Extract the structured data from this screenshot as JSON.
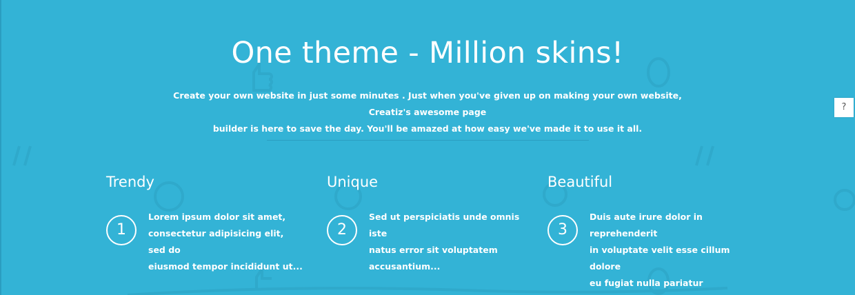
{
  "hero": {
    "title": "One theme - Million skins!",
    "subtitle_line1": "Create your own website in just some minutes . Just when you've given up on making your own website, Creatiz's awesome page",
    "subtitle_line2": "builder is here to save the day. You'll be amazed at how easy we've made it to use it all."
  },
  "features": [
    {
      "title": "Trendy",
      "number": "1",
      "text_line1": "Lorem ipsum dolor sit amet,",
      "text_line2": "consectetur adipisicing elit, sed do",
      "text_line3": "eiusmod tempor incididunt ut..."
    },
    {
      "title": "Unique",
      "number": "2",
      "text_line1": "Sed ut perspiciatis unde omnis iste",
      "text_line2": "natus error sit voluptatem",
      "text_line3": "accusantium..."
    },
    {
      "title": "Beautiful",
      "number": "3",
      "text_line1": "Duis aute irure dolor in reprehenderit",
      "text_line2": "in voluptate velit esse cillum dolore",
      "text_line3": "eu fugiat nulla pariatur"
    }
  ],
  "help_button": {
    "label": "?",
    "icon": "question-icon"
  },
  "colors": {
    "background": "#33b3d6",
    "text": "#ffffff",
    "divider": "#2a9dc0"
  }
}
